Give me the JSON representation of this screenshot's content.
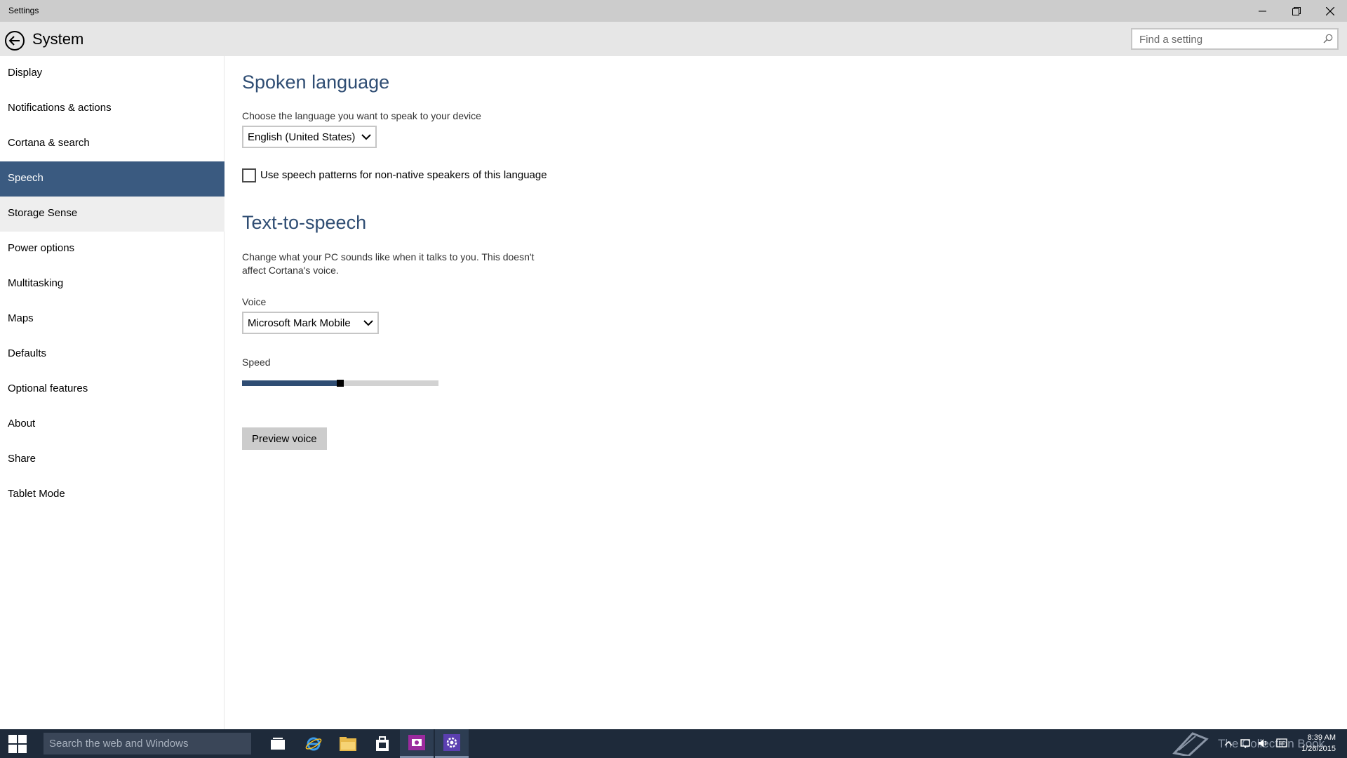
{
  "window": {
    "title": "Settings"
  },
  "header": {
    "title": "System",
    "search_placeholder": "Find a setting"
  },
  "sidebar": {
    "items": [
      {
        "label": "Display"
      },
      {
        "label": "Notifications & actions"
      },
      {
        "label": "Cortana & search"
      },
      {
        "label": "Speech",
        "selected": true
      },
      {
        "label": "Storage Sense",
        "hover": true
      },
      {
        "label": "Power options"
      },
      {
        "label": "Multitasking"
      },
      {
        "label": "Maps"
      },
      {
        "label": "Defaults"
      },
      {
        "label": "Optional features"
      },
      {
        "label": "About"
      },
      {
        "label": "Share"
      },
      {
        "label": "Tablet Mode"
      }
    ]
  },
  "spoken_language": {
    "heading": "Spoken language",
    "description": "Choose the language you want to speak to your device",
    "language_value": "English (United States)",
    "checkbox_label": "Use speech patterns for non-native speakers of this language",
    "checkbox_checked": false
  },
  "tts": {
    "heading": "Text-to-speech",
    "description_line1": "Change what your PC sounds like when it talks to you. This doesn't",
    "description_line2": "affect Cortana's voice.",
    "voice_label": "Voice",
    "voice_value": "Microsoft Mark Mobile",
    "speed_label": "Speed",
    "speed_fraction": 0.5,
    "preview_button": "Preview voice"
  },
  "taskbar": {
    "search_placeholder": "Search the web and Windows",
    "icons": [
      "task-view-icon",
      "internet-explorer-icon",
      "file-explorer-icon",
      "store-icon",
      "camera-app-icon",
      "settings-icon"
    ],
    "watermark": "The Collection Book",
    "time": "8:39 AM",
    "date": "1/26/2015"
  },
  "colors": {
    "accent": "#3a5a80",
    "heading": "#2f4d73",
    "taskbar": "#1e2a3a"
  }
}
